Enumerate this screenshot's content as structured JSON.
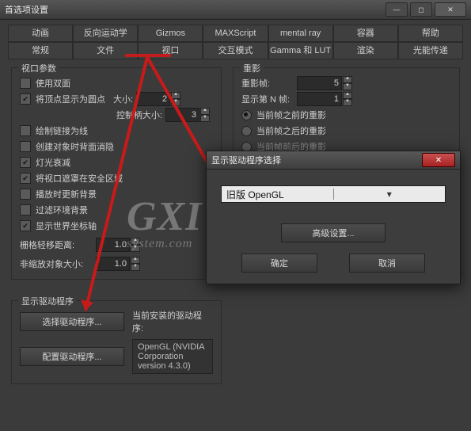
{
  "window": {
    "title": "首选项设置"
  },
  "tabs_row1": [
    "动画",
    "反向运动学",
    "Gizmos",
    "MAXScript",
    "mental ray",
    "容器",
    "帮助"
  ],
  "tabs_row2": [
    "常规",
    "文件",
    "视口",
    "交互模式",
    "Gamma 和 LUT",
    "渲染",
    "光能传递"
  ],
  "viewport_params": {
    "title": "视口参数",
    "use_double_side": "使用双面",
    "show_vertex_as_dot": "将顶点显示为圆点",
    "size_label": "大小:",
    "size_value": "2",
    "handle_size_label": "控制柄大小:",
    "handle_size_value": "3",
    "draw_link_lines": "绘制链接为线",
    "backface_cull_on_create": "创建对象时背面消隐",
    "light_attenuation": "灯光衰减",
    "mask_safe_zone": "将视口遮罩在安全区域",
    "play_new_bg": "播放时更新背景",
    "filter_env_bg": "过滤环境背景",
    "show_world_axis": "显示世界坐标轴",
    "grid_nudge_label": "栅格轻移距离:",
    "grid_nudge_value": "1.0",
    "nonscale_obj_label": "非缩放对象大小:",
    "nonscale_obj_value": "1.0"
  },
  "ghosting": {
    "title": "重影",
    "frames_label": "重影帧:",
    "frames_value": "5",
    "nth_label": "显示第 N 帧:",
    "nth_value": "1",
    "before": "当前帧之前的重影",
    "after": "当前帧之后的重影",
    "both": "当前帧前后的重影"
  },
  "driver": {
    "title": "显示驱动程序",
    "choose_btn": "选择驱动程序...",
    "config_btn": "配置驱动程序...",
    "current_label": "当前安装的驱动程序:",
    "current_value": "OpenGL (NVIDIA Corporation version 4.3.0)"
  },
  "dialog": {
    "title": "显示驱动程序选择",
    "combo_value": "旧版 OpenGL",
    "advanced": "高级设置...",
    "ok": "确定",
    "cancel": "取消"
  },
  "watermark": {
    "main": "GXI 网",
    "sub": "system.com"
  }
}
